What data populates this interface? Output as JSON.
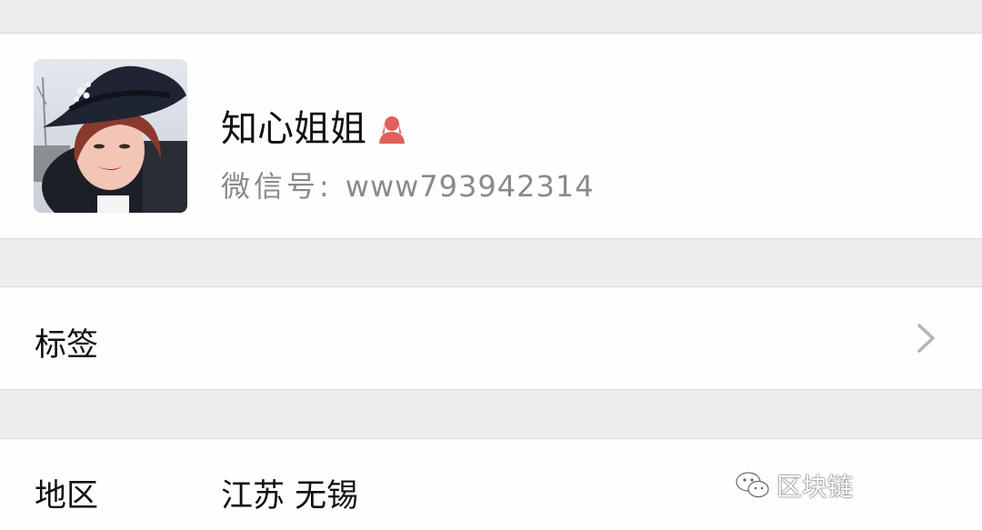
{
  "profile": {
    "name": "知心姐姐",
    "gender_icon": "female-person-icon",
    "gender_color": "#e0615a",
    "wechat_label": "微信号:",
    "wechat_id": "www793942314"
  },
  "rows": {
    "tags_label": "标签",
    "region_label": "地区",
    "region_value": "江苏 无锡"
  },
  "watermark": {
    "text": "区块链",
    "icon": "wechat-icon"
  }
}
